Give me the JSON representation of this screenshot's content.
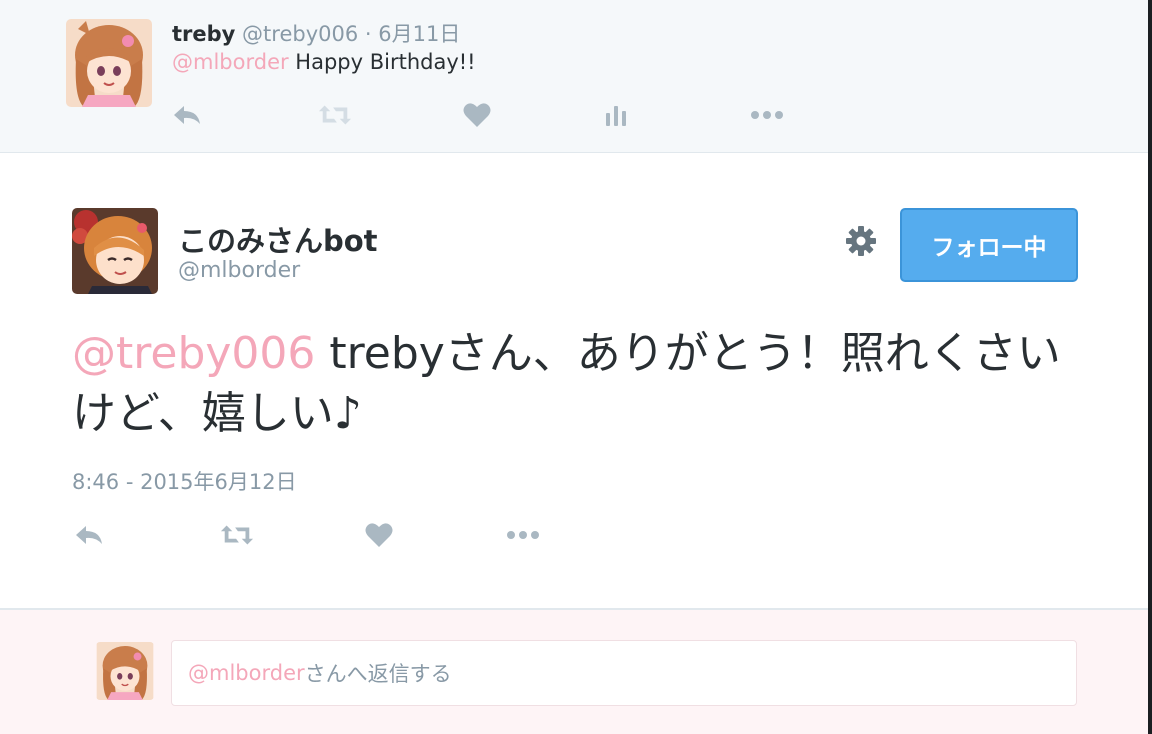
{
  "parent_tweet": {
    "name": "treby",
    "handle": "@treby006",
    "separator": "·",
    "date": "6月11日",
    "mention": "@mlborder",
    "text": " Happy Birthday!!"
  },
  "main_tweet": {
    "name": "このみさんbot",
    "handle": "@mlborder",
    "follow_label": "フォロー中",
    "mention": "@treby006",
    "text": " trebyさん、ありがとう！照れくさいけど、嬉しい♪",
    "timestamp": "8:46 - 2015年6月12日"
  },
  "reply": {
    "mention": "@mlborder",
    "placeholder_rest": "さんへ返信する"
  },
  "icons": {
    "reply": "reply-icon",
    "retweet": "retweet-icon",
    "like": "heart-icon",
    "analytics": "analytics-icon",
    "more": "more-icon",
    "settings": "gear-icon"
  },
  "colors": {
    "mention": "#f4a7b9",
    "secondary_text": "#8899a6",
    "follow_button": "#55acee",
    "action_icon": "#aab8c2",
    "parent_background": "#f5f8fa",
    "reply_background": "#fef4f6"
  }
}
